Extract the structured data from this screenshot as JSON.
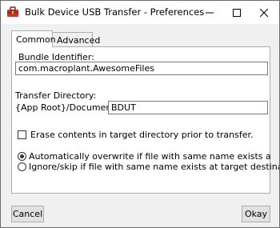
{
  "window": {
    "title": "Bulk Device USB Transfer - Preferences",
    "icons": {
      "app": "toolbox-app-icon",
      "minimize": "minimize-icon",
      "maximize": "maximize-icon",
      "close": "close-icon"
    }
  },
  "tabs": [
    {
      "label": "Common",
      "selected": true
    },
    {
      "label": "Advanced",
      "selected": false
    }
  ],
  "common": {
    "bundle_identifier_label": "Bundle Identifier:",
    "bundle_identifier_value": "com.macroplant.AwesomeFiles",
    "transfer_directory_label": "Transfer Directory:",
    "transfer_directory_prefix": "{App Root}/Documents/",
    "transfer_directory_value": "BDUT",
    "erase_checkbox_label": "Erase contents in target directory prior to transfer.",
    "erase_checked": false,
    "radio_options": [
      {
        "label": "Automatically overwrite if file with same name exists at target destinatio",
        "checked": true
      },
      {
        "label": "Ignore/skip if file with same name exists at target destination.",
        "checked": false
      }
    ]
  },
  "buttons": {
    "cancel": "Cancel",
    "okay": "Okay"
  }
}
